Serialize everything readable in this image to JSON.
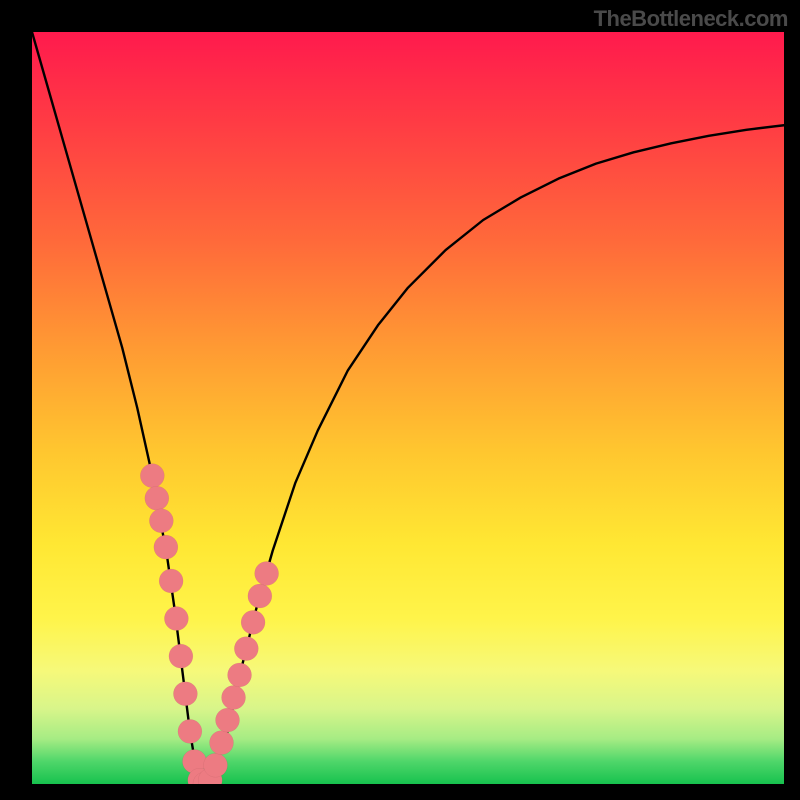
{
  "watermark": "TheBottleneck.com",
  "colors": {
    "dot": "#ed7b82",
    "curve": "#000000",
    "frame": "#000000"
  },
  "chart_data": {
    "type": "line",
    "title": "",
    "xlabel": "",
    "ylabel": "",
    "xlim": [
      0,
      100
    ],
    "ylim": [
      0,
      100
    ],
    "grid": false,
    "legend": false,
    "series": [
      {
        "name": "bottleneck-curve",
        "x": [
          0,
          2,
          4,
          6,
          8,
          10,
          12,
          14,
          16,
          18,
          19,
          20,
          21,
          22,
          23,
          24,
          26,
          28,
          30,
          32,
          35,
          38,
          42,
          46,
          50,
          55,
          60,
          65,
          70,
          75,
          80,
          85,
          90,
          95,
          100
        ],
        "y": [
          100,
          93,
          86,
          79,
          72,
          65,
          58,
          50,
          41,
          30,
          23,
          15,
          7,
          1,
          0,
          1,
          7,
          16,
          24,
          31,
          40,
          47,
          55,
          61,
          66,
          71,
          75,
          78,
          80.5,
          82.5,
          84,
          85.2,
          86.2,
          87,
          87.6
        ]
      }
    ],
    "scatter_points": {
      "name": "sample-dots",
      "points": [
        {
          "x": 16.0,
          "y": 41.0
        },
        {
          "x": 16.6,
          "y": 38.0
        },
        {
          "x": 17.2,
          "y": 35.0
        },
        {
          "x": 17.8,
          "y": 31.5
        },
        {
          "x": 18.5,
          "y": 27.0
        },
        {
          "x": 19.2,
          "y": 22.0
        },
        {
          "x": 19.8,
          "y": 17.0
        },
        {
          "x": 20.4,
          "y": 12.0
        },
        {
          "x": 21.0,
          "y": 7.0
        },
        {
          "x": 21.6,
          "y": 3.0
        },
        {
          "x": 22.3,
          "y": 0.5
        },
        {
          "x": 23.0,
          "y": 0.0
        },
        {
          "x": 23.7,
          "y": 0.5
        },
        {
          "x": 24.4,
          "y": 2.5
        },
        {
          "x": 25.2,
          "y": 5.5
        },
        {
          "x": 26.0,
          "y": 8.5
        },
        {
          "x": 26.8,
          "y": 11.5
        },
        {
          "x": 27.6,
          "y": 14.5
        },
        {
          "x": 28.5,
          "y": 18.0
        },
        {
          "x": 29.4,
          "y": 21.5
        },
        {
          "x": 30.3,
          "y": 25.0
        },
        {
          "x": 31.2,
          "y": 28.0
        }
      ]
    }
  }
}
